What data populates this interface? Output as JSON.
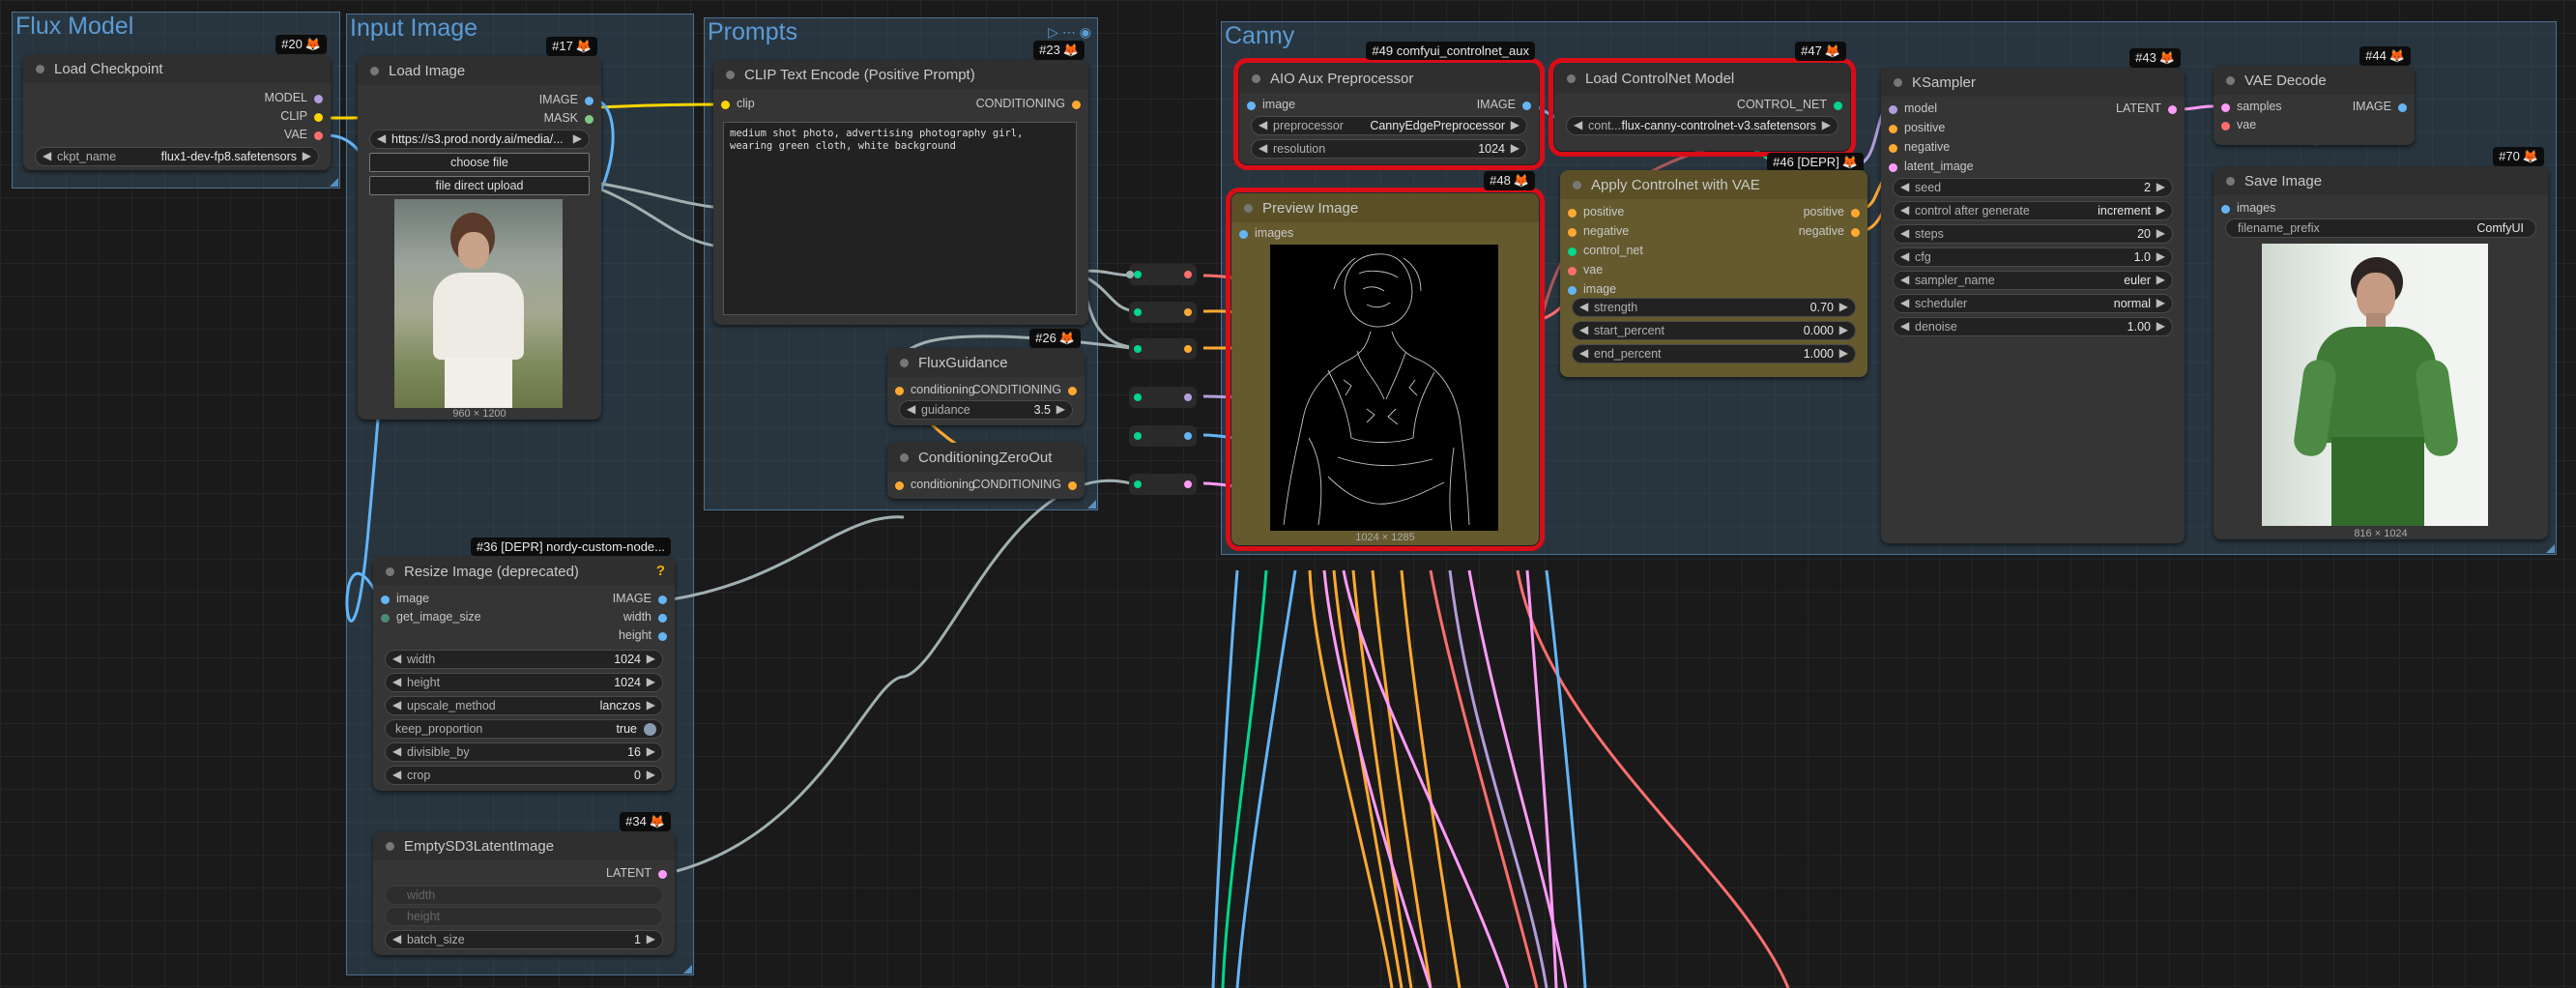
{
  "colors": {
    "model": "#b39ddb",
    "clip": "#ffd500",
    "vae": "#ff6e6e",
    "image": "#64b5f6",
    "mask": "#81c784",
    "conditioning": "#ffa931",
    "latent": "#ff9cf9",
    "control_net": "#00d78d",
    "link_gray": "#a0b0b0",
    "selection": "#d80d17"
  },
  "groups": {
    "flux_model": "Flux Model",
    "input_image": "Input Image",
    "prompts": "Prompts",
    "canny": "Canny"
  },
  "nodes": {
    "load_checkpoint": {
      "id": "#20",
      "title": "Load Checkpoint",
      "outputs": [
        "MODEL",
        "CLIP",
        "VAE"
      ],
      "ckpt_name": {
        "name": "ckpt_name",
        "value": "flux1-dev-fp8.safetensors"
      }
    },
    "load_image": {
      "id": "#17",
      "title": "Load Image",
      "outputs": [
        "IMAGE",
        "MASK"
      ],
      "url": "https://s3.prod.nordy.ai/media/...",
      "choose_file": "choose file",
      "direct_upload": "file direct upload",
      "caption": "960 × 1200"
    },
    "clip_text": {
      "id": "#23",
      "title": "CLIP Text Encode (Positive Prompt)",
      "input": "clip",
      "output": "CONDITIONING",
      "text": "medium shot photo, advertising photography girl, wearing green cloth, white background"
    },
    "flux_guidance": {
      "id": "#26",
      "title": "FluxGuidance",
      "input": "conditioning",
      "output": "CONDITIONING",
      "guidance": {
        "name": "guidance",
        "value": "3.5"
      }
    },
    "cond_zero": {
      "title": "ConditioningZeroOut",
      "input": "conditioning",
      "output": "CONDITIONING"
    },
    "resize": {
      "id": "#36 [DEPR] nordy-custom-node...",
      "title": "Resize Image (deprecated)",
      "inputs": [
        "image",
        "get_image_size"
      ],
      "outputs": [
        "IMAGE",
        "width",
        "height"
      ],
      "widgets": [
        {
          "name": "width",
          "value": "1024"
        },
        {
          "name": "height",
          "value": "1024"
        },
        {
          "name": "upscale_method",
          "value": "lanczos"
        },
        {
          "name": "keep_proportion",
          "value": "true"
        },
        {
          "name": "divisible_by",
          "value": "16"
        },
        {
          "name": "crop",
          "value": "0"
        }
      ],
      "help": "?"
    },
    "empty_latent": {
      "id": "#34",
      "title": "EmptySD3LatentImage",
      "output": "LATENT",
      "faded_inputs": [
        "width",
        "height"
      ],
      "batch_size": {
        "name": "batch_size",
        "value": "1"
      }
    },
    "aio": {
      "id": "#49 comfyui_controlnet_aux",
      "title": "AIO Aux Preprocessor",
      "input": "image",
      "output": "IMAGE",
      "preprocessor": {
        "name": "preprocessor",
        "value": "CannyEdgePreprocessor"
      },
      "resolution": {
        "name": "resolution",
        "value": "1024"
      }
    },
    "load_cn": {
      "id": "#47",
      "title": "Load ControlNet Model",
      "output": "CONTROL_NET",
      "control_net": {
        "name": "cont...",
        "value": "flux-canny-controlnet-v3.safetensors"
      }
    },
    "apply_cn": {
      "id": "#46 [DEPR]",
      "title": "Apply Controlnet with VAE",
      "inputs": [
        "positive",
        "negative",
        "control_net",
        "vae",
        "image"
      ],
      "outputs": [
        "positive",
        "negative"
      ],
      "widgets": [
        {
          "name": "strength",
          "value": "0.70"
        },
        {
          "name": "start_percent",
          "value": "0.000"
        },
        {
          "name": "end_percent",
          "value": "1.000"
        }
      ]
    },
    "preview": {
      "id": "#48",
      "title": "Preview Image",
      "input": "images",
      "caption": "1024 × 1285"
    },
    "ksampler": {
      "id": "#43",
      "title": "KSampler",
      "inputs": [
        "model",
        "positive",
        "negative",
        "latent_image"
      ],
      "output": "LATENT",
      "widgets": [
        {
          "name": "seed",
          "value": "2"
        },
        {
          "name": "control after generate",
          "value": "increment"
        },
        {
          "name": "steps",
          "value": "20"
        },
        {
          "name": "cfg",
          "value": "1.0"
        },
        {
          "name": "sampler_name",
          "value": "euler"
        },
        {
          "name": "scheduler",
          "value": "normal"
        },
        {
          "name": "denoise",
          "value": "1.00"
        }
      ]
    },
    "vae_decode": {
      "id": "#44",
      "title": "VAE Decode",
      "inputs": [
        "samples",
        "vae"
      ],
      "output": "IMAGE"
    },
    "save_image": {
      "id": "#70",
      "title": "Save Image",
      "input": "images",
      "filename_prefix": {
        "name": "filename_prefix",
        "value": "ComfyUI"
      },
      "caption": "816 × 1024"
    }
  },
  "fox": "🦊",
  "arrows": {
    "left": "◀",
    "right": "▶"
  }
}
